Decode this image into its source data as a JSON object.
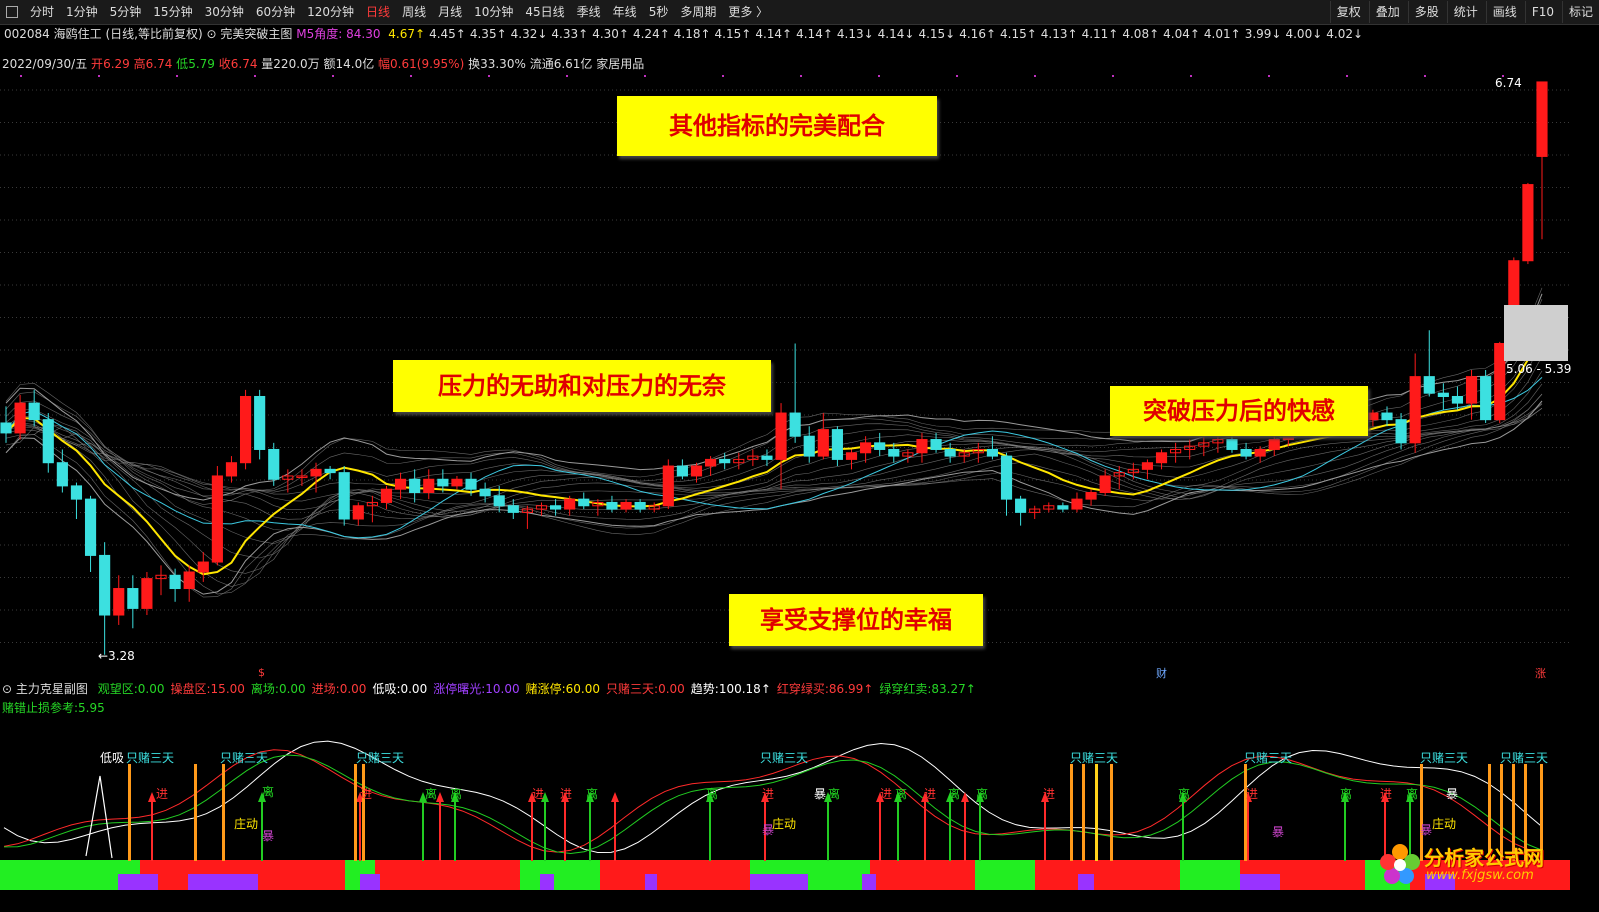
{
  "toolbar": {
    "periods": [
      "分时",
      "1分钟",
      "5分钟",
      "15分钟",
      "30分钟",
      "60分钟",
      "120分钟",
      "日线",
      "周线",
      "月线",
      "10分钟",
      "45日线",
      "季线",
      "年线",
      "5秒",
      "多周期",
      "更多 〉"
    ],
    "active_period": "日线",
    "right_buttons": [
      "复权",
      "叠加",
      "多股",
      "统计",
      "画线",
      "F10",
      "标记"
    ]
  },
  "stock": {
    "code": "002084",
    "name": "海鸥住工",
    "period_info": "(日线,等比前复权)",
    "indicator_main": "完美突破主图",
    "m5_label": "M5角度:",
    "m5_value": "84.30",
    "m5_series": [
      "4.67↑",
      "4.45↑",
      "4.35↑",
      "4.32↓",
      "4.33↑",
      "4.30↑",
      "4.24↑",
      "4.18↑",
      "4.15↑",
      "4.14↑",
      "4.14↑",
      "4.13↓",
      "4.14↓",
      "4.15↓",
      "4.16↑",
      "4.15↑",
      "4.13↑",
      "4.11↑",
      "4.08↑",
      "4.04↑",
      "4.01↑",
      "3.99↓",
      "4.00↓",
      "4.02↓"
    ],
    "m5_last": "4.02"
  },
  "quote": {
    "date": "2022/09/30/五",
    "open_label": "开",
    "open": "6.29",
    "high_label": "高",
    "high": "6.74",
    "low_label": "低",
    "low": "5.79",
    "close_label": "收",
    "close": "6.74",
    "volume": "量220.0万",
    "amount": "额14.0亿",
    "change": "幅0.61(9.95%)",
    "turnover": "换33.30%",
    "float_cap": "流通6.61亿",
    "industry": "家居用品"
  },
  "banners": {
    "b1": "其他指标的完美配合",
    "b2": "压力的无助和对压力的无奈",
    "b3": "突破压力后的快感",
    "b4": "享受支撑位的幸福"
  },
  "price_labels": {
    "high_mark": "6.74",
    "low_mark": "←3.28",
    "range": "5.06 - 5.39",
    "marker_s": "$",
    "marker_cai": "财",
    "marker_zhang": "涨"
  },
  "sub_indicator": {
    "name": "主力克星副图",
    "items": [
      {
        "label": "观望区:",
        "value": "0.00",
        "color": "#26d626"
      },
      {
        "label": "操盘区:",
        "value": "15.00",
        "color": "#ff3b3b"
      },
      {
        "label": "离场:",
        "value": "0.00",
        "color": "#26d626"
      },
      {
        "label": "进场:",
        "value": "0.00",
        "color": "#ff3b3b"
      },
      {
        "label": "低吸:",
        "value": "0.00",
        "color": "#ffffff"
      },
      {
        "label": "涨停曙光:",
        "value": "10.00",
        "color": "#a040ff"
      },
      {
        "label": "赌涨停:",
        "value": "60.00",
        "color": "#ffe600"
      },
      {
        "label": "只赌三天:",
        "value": "0.00",
        "color": "#ff3b3b"
      },
      {
        "label": "趋势:",
        "value": "100.18↑",
        "color": "#ffffff"
      },
      {
        "label": "红穿绿买:",
        "value": "86.99↑",
        "color": "#ff3b3b"
      },
      {
        "label": "绿穿红卖:",
        "value": "83.27↑",
        "color": "#26d626"
      }
    ],
    "stop_loss_label": "赌错止损参考:",
    "stop_loss_value": "5.95"
  },
  "sub_labels": {
    "dixi": "低吸",
    "zhidu": "只赌三天",
    "jin": "进",
    "li": "离",
    "zhuangdong": "庄动",
    "bao": "暴"
  },
  "logo": {
    "name": "分析家公式网",
    "url": "www.fxjgsw.com"
  },
  "colors": {
    "up": "#ff1a1a",
    "down": "#3ce0e0",
    "ma": "#ffe600",
    "band": "#9a9a9a",
    "bg": "#000000"
  },
  "chart_data": {
    "type": "candlestick",
    "title": "",
    "ohlc": [
      [
        4.68,
        4.78,
        4.56,
        4.62
      ],
      [
        4.62,
        4.85,
        4.58,
        4.8
      ],
      [
        4.8,
        4.88,
        4.66,
        4.7
      ],
      [
        4.7,
        4.74,
        4.38,
        4.44
      ],
      [
        4.44,
        4.52,
        4.26,
        4.3
      ],
      [
        4.3,
        4.32,
        4.1,
        4.22
      ],
      [
        4.22,
        4.24,
        3.78,
        3.88
      ],
      [
        3.88,
        3.96,
        3.28,
        3.52
      ],
      [
        3.52,
        3.76,
        3.46,
        3.68
      ],
      [
        3.68,
        3.76,
        3.44,
        3.56
      ],
      [
        3.56,
        3.78,
        3.52,
        3.74
      ],
      [
        3.74,
        3.82,
        3.64,
        3.76
      ],
      [
        3.76,
        3.8,
        3.6,
        3.68
      ],
      [
        3.68,
        3.82,
        3.6,
        3.78
      ],
      [
        3.78,
        3.9,
        3.72,
        3.84
      ],
      [
        3.84,
        4.42,
        3.82,
        4.36
      ],
      [
        4.36,
        4.48,
        4.32,
        4.44
      ],
      [
        4.44,
        4.88,
        4.4,
        4.84
      ],
      [
        4.84,
        4.88,
        4.46,
        4.52
      ],
      [
        4.52,
        4.56,
        4.3,
        4.34
      ],
      [
        4.34,
        4.4,
        4.26,
        4.36
      ],
      [
        4.36,
        4.4,
        4.3,
        4.36
      ],
      [
        4.36,
        4.44,
        4.26,
        4.4
      ],
      [
        4.4,
        4.42,
        4.34,
        4.38
      ],
      [
        4.38,
        4.42,
        4.06,
        4.1
      ],
      [
        4.1,
        4.2,
        4.06,
        4.18
      ],
      [
        4.18,
        4.24,
        4.08,
        4.2
      ],
      [
        4.2,
        4.3,
        4.16,
        4.28
      ],
      [
        4.28,
        4.38,
        4.22,
        4.34
      ],
      [
        4.34,
        4.4,
        4.2,
        4.26
      ],
      [
        4.26,
        4.4,
        4.22,
        4.34
      ],
      [
        4.34,
        4.4,
        4.26,
        4.3
      ],
      [
        4.3,
        4.36,
        4.28,
        4.34
      ],
      [
        4.34,
        4.38,
        4.24,
        4.28
      ],
      [
        4.28,
        4.32,
        4.2,
        4.24
      ],
      [
        4.24,
        4.3,
        4.14,
        4.18
      ],
      [
        4.18,
        4.22,
        4.1,
        4.14
      ],
      [
        4.14,
        4.18,
        4.04,
        4.16
      ],
      [
        4.16,
        4.2,
        4.12,
        4.18
      ],
      [
        4.18,
        4.22,
        4.12,
        4.16
      ],
      [
        4.16,
        4.24,
        4.12,
        4.22
      ],
      [
        4.22,
        4.26,
        4.16,
        4.18
      ],
      [
        4.18,
        4.22,
        4.12,
        4.2
      ],
      [
        4.2,
        4.24,
        4.14,
        4.16
      ],
      [
        4.16,
        4.22,
        4.14,
        4.2
      ],
      [
        4.2,
        4.22,
        4.14,
        4.16
      ],
      [
        4.16,
        4.2,
        4.14,
        4.18
      ],
      [
        4.18,
        4.46,
        4.16,
        4.42
      ],
      [
        4.42,
        4.46,
        4.34,
        4.36
      ],
      [
        4.36,
        4.44,
        4.32,
        4.42
      ],
      [
        4.42,
        4.48,
        4.36,
        4.46
      ],
      [
        4.46,
        4.5,
        4.4,
        4.44
      ],
      [
        4.44,
        4.5,
        4.4,
        4.46
      ],
      [
        4.46,
        4.52,
        4.42,
        4.48
      ],
      [
        4.48,
        4.52,
        4.42,
        4.46
      ],
      [
        4.46,
        4.8,
        4.28,
        4.74
      ],
      [
        4.74,
        5.16,
        4.56,
        4.6
      ],
      [
        4.6,
        4.66,
        4.44,
        4.48
      ],
      [
        4.48,
        4.74,
        4.46,
        4.64
      ],
      [
        4.64,
        4.66,
        4.42,
        4.46
      ],
      [
        4.46,
        4.52,
        4.4,
        4.5
      ],
      [
        4.5,
        4.6,
        4.44,
        4.56
      ],
      [
        4.56,
        4.62,
        4.48,
        4.52
      ],
      [
        4.52,
        4.56,
        4.44,
        4.48
      ],
      [
        4.48,
        4.52,
        4.44,
        4.5
      ],
      [
        4.5,
        4.62,
        4.44,
        4.58
      ],
      [
        4.58,
        4.62,
        4.5,
        4.52
      ],
      [
        4.52,
        4.56,
        4.44,
        4.48
      ],
      [
        4.48,
        4.52,
        4.44,
        4.5
      ],
      [
        4.5,
        4.56,
        4.44,
        4.52
      ],
      [
        4.52,
        4.6,
        4.46,
        4.48
      ],
      [
        4.48,
        4.5,
        4.12,
        4.22
      ],
      [
        4.22,
        4.24,
        4.06,
        4.14
      ],
      [
        4.14,
        4.18,
        4.1,
        4.16
      ],
      [
        4.16,
        4.2,
        4.14,
        4.18
      ],
      [
        4.18,
        4.2,
        4.14,
        4.16
      ],
      [
        4.16,
        4.26,
        4.14,
        4.22
      ],
      [
        4.22,
        4.28,
        4.18,
        4.26
      ],
      [
        4.26,
        4.4,
        4.24,
        4.36
      ],
      [
        4.36,
        4.42,
        4.28,
        4.38
      ],
      [
        4.38,
        4.44,
        4.34,
        4.4
      ],
      [
        4.4,
        4.46,
        4.34,
        4.44
      ],
      [
        4.44,
        4.52,
        4.4,
        4.5
      ],
      [
        4.5,
        4.56,
        4.44,
        4.52
      ],
      [
        4.52,
        4.58,
        4.46,
        4.54
      ],
      [
        4.54,
        4.6,
        4.48,
        4.56
      ],
      [
        4.56,
        4.62,
        4.5,
        4.58
      ],
      [
        4.58,
        4.62,
        4.5,
        4.52
      ],
      [
        4.52,
        4.56,
        4.46,
        4.48
      ],
      [
        4.48,
        4.54,
        4.44,
        4.52
      ],
      [
        4.52,
        4.6,
        4.48,
        4.58
      ],
      [
        4.58,
        4.7,
        4.54,
        4.66
      ],
      [
        4.66,
        4.72,
        4.6,
        4.68
      ],
      [
        4.68,
        4.74,
        4.62,
        4.7
      ],
      [
        4.7,
        4.76,
        4.64,
        4.72
      ],
      [
        4.72,
        4.76,
        4.66,
        4.68
      ],
      [
        4.68,
        4.74,
        4.64,
        4.7
      ],
      [
        4.7,
        4.76,
        4.66,
        4.74
      ],
      [
        4.74,
        4.78,
        4.66,
        4.7
      ],
      [
        4.7,
        4.74,
        4.52,
        4.56
      ],
      [
        4.56,
        5.1,
        4.5,
        4.96
      ],
      [
        4.96,
        5.24,
        4.84,
        4.86
      ],
      [
        4.86,
        4.92,
        4.76,
        4.84
      ],
      [
        4.84,
        4.9,
        4.76,
        4.8
      ],
      [
        4.8,
        5.0,
        4.7,
        4.96
      ],
      [
        4.96,
        5.0,
        4.68,
        4.7
      ],
      [
        4.7,
        5.17,
        4.68,
        5.16
      ],
      [
        5.16,
        5.68,
        5.14,
        5.66
      ],
      [
        5.66,
        6.13,
        5.64,
        6.12
      ],
      [
        6.29,
        6.74,
        5.79,
        6.74
      ]
    ],
    "ylim": [
      3.2,
      6.8
    ]
  }
}
